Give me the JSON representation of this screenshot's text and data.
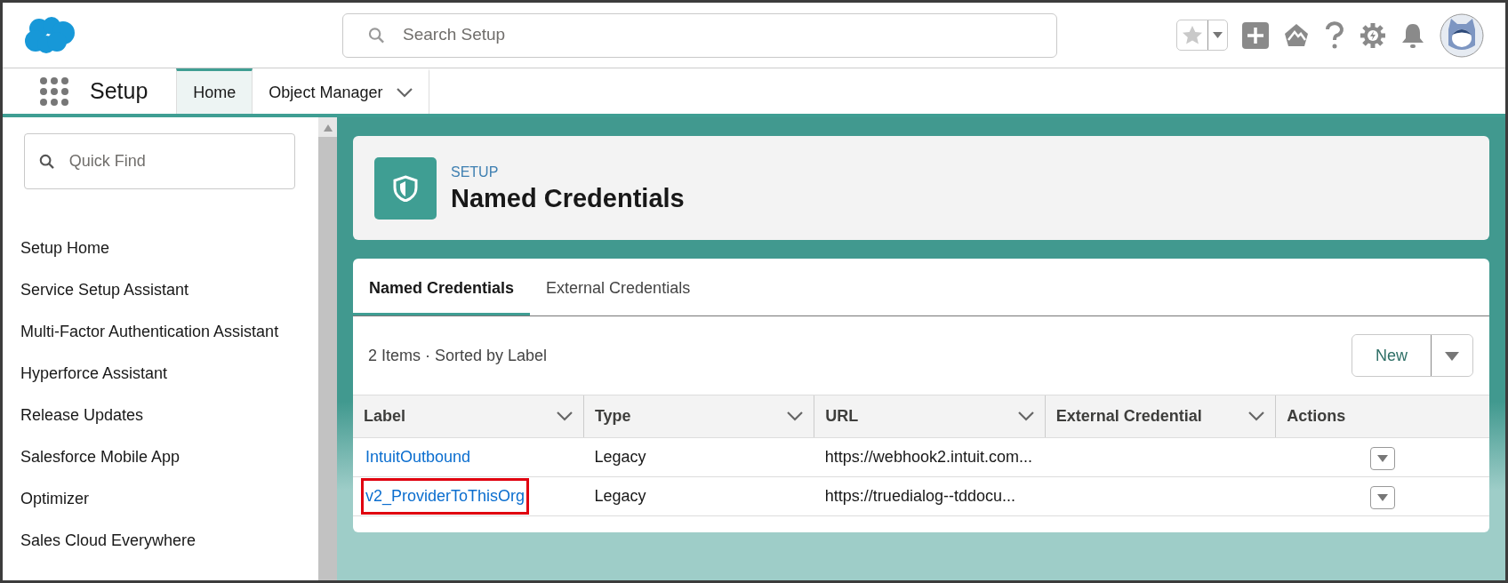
{
  "header": {
    "search": {
      "placeholder": "Search Setup"
    },
    "favorites": {
      "starred": false
    }
  },
  "nav": {
    "app_name": "Setup",
    "tabs": [
      {
        "label": "Home",
        "selected": true,
        "has_menu": false
      },
      {
        "label": "Object Manager",
        "selected": false,
        "has_menu": true
      }
    ]
  },
  "sidebar": {
    "quick_find": {
      "placeholder": "Quick Find"
    },
    "items": [
      {
        "label": "Setup Home"
      },
      {
        "label": "Service Setup Assistant"
      },
      {
        "label": "Multi-Factor Authentication Assistant"
      },
      {
        "label": "Hyperforce Assistant"
      },
      {
        "label": "Release Updates"
      },
      {
        "label": "Salesforce Mobile App"
      },
      {
        "label": "Optimizer"
      },
      {
        "label": "Sales Cloud Everywhere"
      }
    ]
  },
  "page_header": {
    "eyebrow": "SETUP",
    "title": "Named Credentials"
  },
  "tabs": [
    {
      "label": "Named Credentials",
      "selected": true
    },
    {
      "label": "External Credentials",
      "selected": false
    }
  ],
  "list_info": "2 Items · Sorted by Label",
  "new_button": "New",
  "table": {
    "columns": [
      {
        "label": "Label",
        "sortable": true
      },
      {
        "label": "Type",
        "sortable": true
      },
      {
        "label": "URL",
        "sortable": true
      },
      {
        "label": "External Credential",
        "sortable": true
      },
      {
        "label": "Actions",
        "sortable": false
      }
    ],
    "rows": [
      {
        "label": "IntuitOutbound",
        "type": "Legacy",
        "url": "https://webhook2.intuit.com...",
        "highlighted": false
      },
      {
        "label": "v2_ProviderToThisOrg",
        "type": "Legacy",
        "url": "https://truedialog--tddocu...",
        "highlighted": true
      }
    ]
  }
}
